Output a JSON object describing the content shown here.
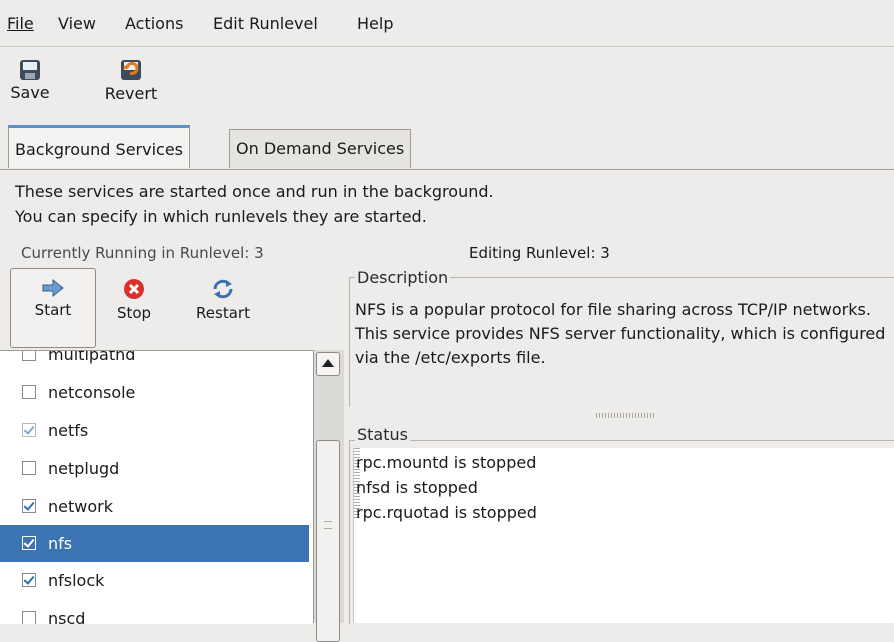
{
  "menu": {
    "file": "File",
    "view": "View",
    "actions": "Actions",
    "edit_runlevel": "Edit Runlevel",
    "help": "Help"
  },
  "toolbar": {
    "save": "Save",
    "revert": "Revert"
  },
  "tabs": {
    "background": "Background Services",
    "on_demand": "On Demand Services"
  },
  "info": {
    "line1": "These services are started once and run in the background.",
    "line2": "You can specify in which runlevels they are started.",
    "current": "Currently Running in Runlevel: 3",
    "editing": "Editing Runlevel: 3"
  },
  "service_toolbar": {
    "start": "Start",
    "stop": "Stop",
    "restart": "Restart"
  },
  "services": [
    {
      "name": "multipathd",
      "checked": false
    },
    {
      "name": "netconsole",
      "checked": false
    },
    {
      "name": "netfs",
      "checked": true
    },
    {
      "name": "netplugd",
      "checked": false
    },
    {
      "name": "network",
      "checked": true
    },
    {
      "name": "nfs",
      "checked": true,
      "selected": true
    },
    {
      "name": "nfslock",
      "checked": true
    },
    {
      "name": "nscd",
      "checked": false
    }
  ],
  "description": {
    "label": "Description",
    "text": "NFS is a popular protocol for file sharing across TCP/IP networks. This service provides NFS server functionality, which is configured via the /etc/exports file."
  },
  "status": {
    "label": "Status",
    "lines": [
      "rpc.mountd is stopped",
      "nfsd is stopped",
      "rpc.rquotad is stopped"
    ]
  },
  "colors": {
    "selection": "#3b73b3",
    "window_bg": "#edeceb",
    "tab_accent": "#5b8fc7"
  }
}
